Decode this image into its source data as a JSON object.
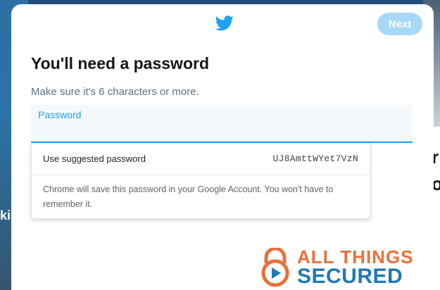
{
  "background": {
    "left_text": "ki",
    "right_text_1": "r",
    "right_text_2": "o"
  },
  "modal": {
    "logo_icon": "twitter-bird-icon",
    "next_label": "Next",
    "title": "You'll need a password",
    "subtitle": "Make sure it's 6 characters or more.",
    "password_field": {
      "label": "Password",
      "value": ""
    }
  },
  "autofill": {
    "suggest_label": "Use suggested password",
    "suggested_password": "UJ8AmttWYet7VzN",
    "note": "Chrome will save this password in your Google Account. You won't have to remember it."
  },
  "watermark": {
    "line1": "ALL THINGS",
    "line2": "SECURED",
    "icon": "padlock-play-icon"
  },
  "colors": {
    "accent": "#1da1f2",
    "next_disabled": "#a7d8f7",
    "watermark_orange": "#e8713a",
    "watermark_blue": "#1f78b4"
  }
}
